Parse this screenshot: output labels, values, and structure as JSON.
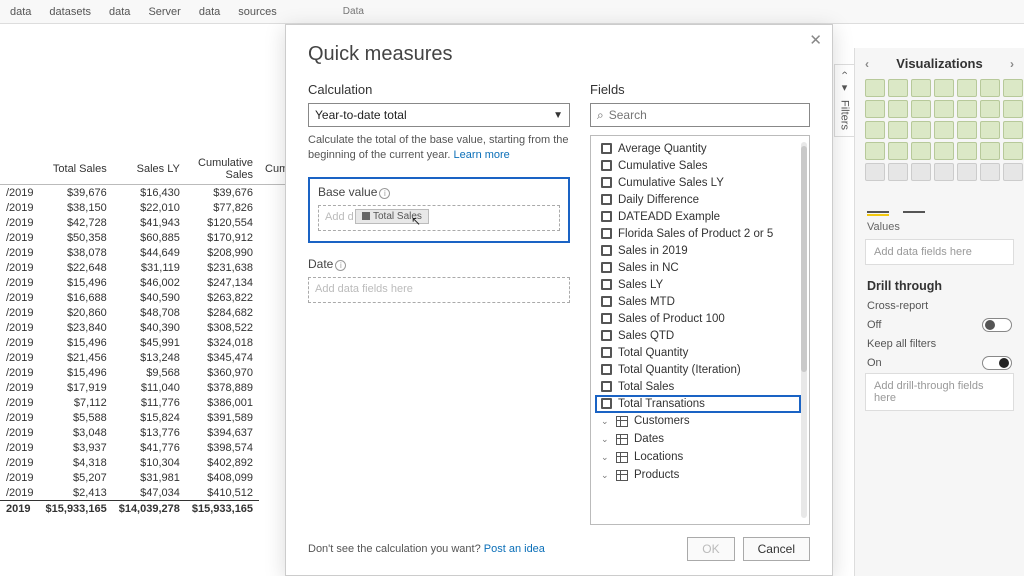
{
  "ribbon": {
    "items": [
      "data",
      "datasets",
      "data",
      "Server",
      "data",
      "sources"
    ],
    "group_label": "Data"
  },
  "table": {
    "headers": [
      "",
      "Total Sales",
      "Sales LY",
      "Cumulative Sales",
      "Cumul"
    ],
    "rows": [
      [
        "/2019",
        "$39,676",
        "$16,430",
        "$39,676"
      ],
      [
        "/2019",
        "$38,150",
        "$22,010",
        "$77,826"
      ],
      [
        "/2019",
        "$42,728",
        "$41,943",
        "$120,554"
      ],
      [
        "/2019",
        "$50,358",
        "$60,885",
        "$170,912"
      ],
      [
        "/2019",
        "$38,078",
        "$44,649",
        "$208,990"
      ],
      [
        "/2019",
        "$22,648",
        "$31,119",
        "$231,638"
      ],
      [
        "/2019",
        "$15,496",
        "$46,002",
        "$247,134"
      ],
      [
        "/2019",
        "$16,688",
        "$40,590",
        "$263,822"
      ],
      [
        "/2019",
        "$20,860",
        "$48,708",
        "$284,682"
      ],
      [
        "/2019",
        "$23,840",
        "$40,390",
        "$308,522"
      ],
      [
        "/2019",
        "$15,496",
        "$45,991",
        "$324,018"
      ],
      [
        "/2019",
        "$21,456",
        "$13,248",
        "$345,474"
      ],
      [
        "/2019",
        "$15,496",
        "$9,568",
        "$360,970"
      ],
      [
        "/2019",
        "$17,919",
        "$11,040",
        "$378,889"
      ],
      [
        "/2019",
        "$7,112",
        "$11,776",
        "$386,001"
      ],
      [
        "/2019",
        "$5,588",
        "$15,824",
        "$391,589"
      ],
      [
        "/2019",
        "$3,048",
        "$13,776",
        "$394,637"
      ],
      [
        "/2019",
        "$3,937",
        "$41,776",
        "$398,574"
      ],
      [
        "/2019",
        "$4,318",
        "$10,304",
        "$402,892"
      ],
      [
        "/2019",
        "$5,207",
        "$31,981",
        "$408,099"
      ],
      [
        "/2019",
        "$2,413",
        "$47,034",
        "$410,512"
      ]
    ],
    "total": [
      "2019",
      "$15,933,165",
      "$14,039,278",
      "$15,933,165"
    ]
  },
  "modal": {
    "title": "Quick measures",
    "calc_label": "Calculation",
    "calc_value": "Year-to-date total",
    "calc_hint_a": "Calculate the total of the base value, starting from the beginning of the current year. ",
    "calc_hint_link": "Learn more",
    "base_label": "Base value",
    "base_placeholder": "Add d",
    "chip_text": "Total Sales",
    "date_label": "Date",
    "date_placeholder": "Add data fields here",
    "fields_label": "Fields",
    "search_placeholder": "Search",
    "fields": [
      "Average Quantity",
      "Cumulative Sales",
      "Cumulative Sales LY",
      "Daily Difference",
      "DATEADD Example",
      "Florida Sales of Product 2 or 5",
      "Sales in 2019",
      "Sales in NC",
      "Sales LY",
      "Sales MTD",
      "Sales of Product 100",
      "Sales QTD",
      "Total Quantity",
      "Total Quantity (Iteration)",
      "Total Sales",
      "Total Transations"
    ],
    "tables": [
      "Customers",
      "Dates",
      "Locations",
      "Products"
    ],
    "footer_text": "Don't see the calculation you want? ",
    "footer_link": "Post an idea",
    "ok": "OK",
    "cancel": "Cancel",
    "highlighted_field_index": 14
  },
  "filters_tab": "Filters",
  "viz": {
    "pane_title": "Visualizations",
    "values_label": "Values",
    "values_placeholder": "Add data fields here",
    "drill_title": "Drill through",
    "cross_label": "Cross-report",
    "off_label": "Off",
    "keep_label": "Keep all filters",
    "on_label": "On",
    "drill_placeholder": "Add drill-through fields here"
  }
}
